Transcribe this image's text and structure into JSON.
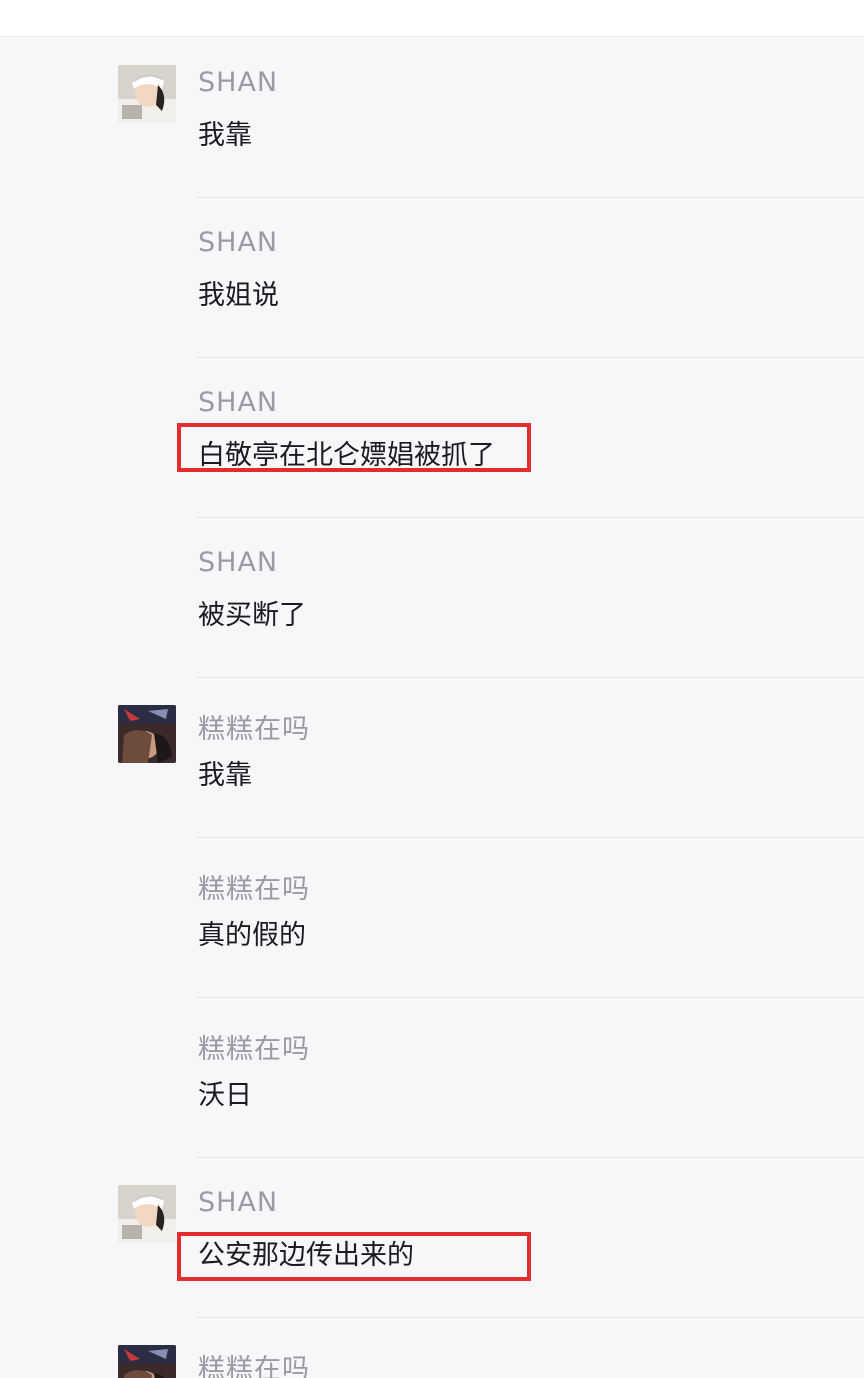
{
  "messages": [
    {
      "sender": "SHAN",
      "text": "我靠",
      "avatar": "girl-avatar"
    },
    {
      "sender": "SHAN",
      "text": "我姐说",
      "avatar": null
    },
    {
      "sender": "SHAN",
      "text": "白敬亭在北仑嫖娼被抓了",
      "avatar": null,
      "highlighted": true
    },
    {
      "sender": "SHAN",
      "text": "被买断了",
      "avatar": null
    },
    {
      "sender": "糕糕在吗",
      "text": "我靠",
      "avatar": "dark-avatar"
    },
    {
      "sender": "糕糕在吗",
      "text": "真的假的",
      "avatar": null
    },
    {
      "sender": "糕糕在吗",
      "text": "沃日",
      "avatar": null
    },
    {
      "sender": "SHAN",
      "text": "公安那边传出来的",
      "avatar": "girl-avatar",
      "highlighted": true
    },
    {
      "sender": "糕糕在吗",
      "text": "",
      "avatar": "dark-avatar"
    }
  ],
  "colors": {
    "highlight_border": "#e02d2d",
    "sender_text": "#9a9aa6",
    "message_text": "#1b1b22"
  }
}
